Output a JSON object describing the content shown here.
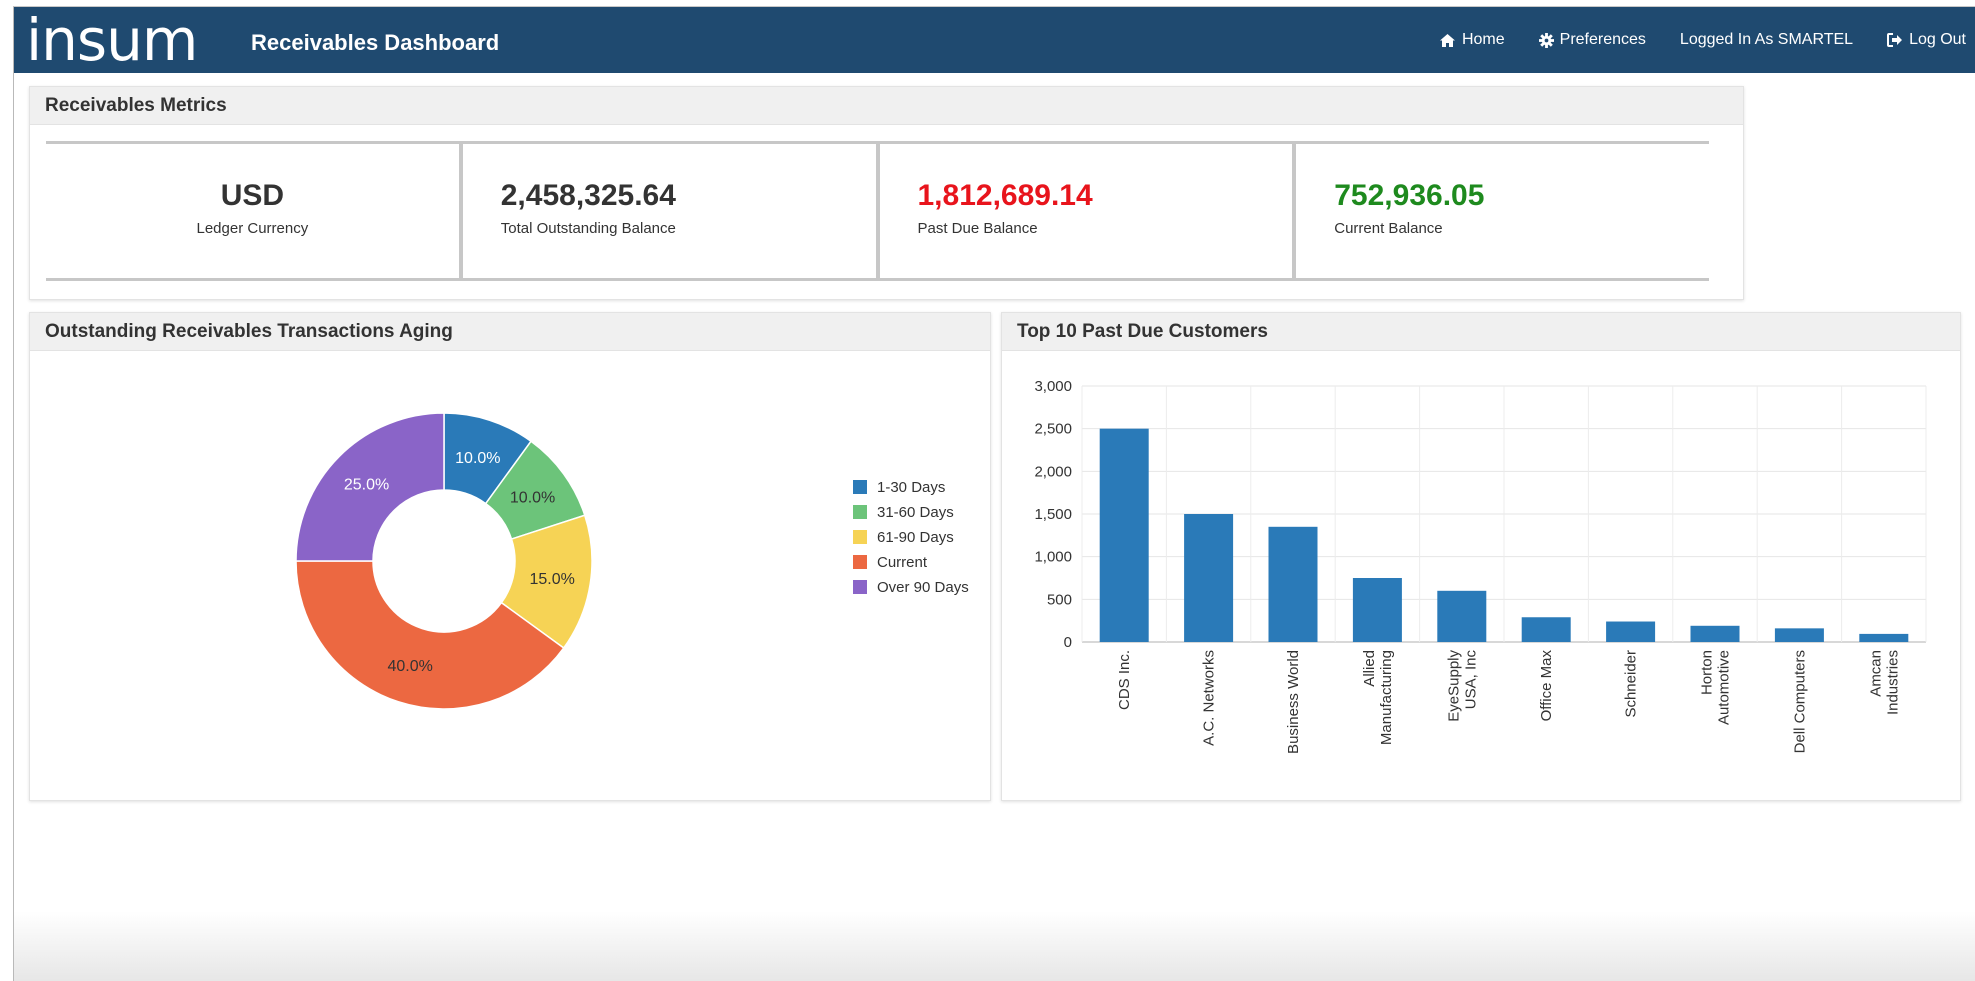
{
  "header": {
    "logo_text": "insum",
    "app_title": "Receivables Dashboard",
    "nav": [
      {
        "label": "Home",
        "icon": "home-icon"
      },
      {
        "label": "Preferences",
        "icon": "gear-icon"
      },
      {
        "label": "Logged In As SMARTEL",
        "icon": null
      },
      {
        "label": "Log Out",
        "icon": "logout-icon"
      }
    ],
    "bg_color": "#1f4a70"
  },
  "metrics": {
    "title": "Receivables Metrics",
    "items": [
      {
        "value": "USD",
        "label": "Ledger Currency",
        "color": "#333333"
      },
      {
        "value": "2,458,325.64",
        "label": "Total Outstanding Balance",
        "color": "#333333"
      },
      {
        "value": "1,812,689.14",
        "label": "Past Due Balance",
        "color": "#e8141c"
      },
      {
        "value": "752,936.05",
        "label": "Current Balance",
        "color": "#1e8a1e"
      }
    ]
  },
  "aging": {
    "title": "Outstanding Receivables Transactions Aging"
  },
  "top_customers": {
    "title": "Top 10 Past Due Customers"
  },
  "chart_data": [
    {
      "type": "pie",
      "donut": true,
      "categories": [
        "1-30 Days",
        "31-60 Days",
        "61-90 Days",
        "Current",
        "Over 90 Days"
      ],
      "values": [
        10.0,
        10.0,
        15.0,
        40.0,
        25.0
      ],
      "data_labels": [
        "10.0%",
        "10.0%",
        "15.0%",
        "40.0%",
        "25.0%"
      ],
      "colors": [
        "#2a7ab8",
        "#6cc47a",
        "#f6d355",
        "#ec6841",
        "#8a64c8"
      ],
      "legend": "right"
    },
    {
      "type": "bar",
      "categories": [
        [
          "CDS Inc."
        ],
        [
          "A.C. Networks"
        ],
        [
          "Business World"
        ],
        [
          "Allied",
          "Manufacturing"
        ],
        [
          "EyeSupply",
          "USA, Inc"
        ],
        [
          "Office Max"
        ],
        [
          "Schneider"
        ],
        [
          "Horton",
          "Automotive"
        ],
        [
          "Dell Computers"
        ],
        [
          "Amcan",
          "Industries"
        ]
      ],
      "values": [
        2500,
        1500,
        1350,
        750,
        600,
        290,
        240,
        190,
        160,
        95
      ],
      "ylim": [
        0,
        3000
      ],
      "yticks": [
        "0",
        "500",
        "1,000",
        "1,500",
        "2,000",
        "2,500",
        "3,000"
      ],
      "grid": true,
      "bar_color": "#2a7ab8"
    }
  ]
}
